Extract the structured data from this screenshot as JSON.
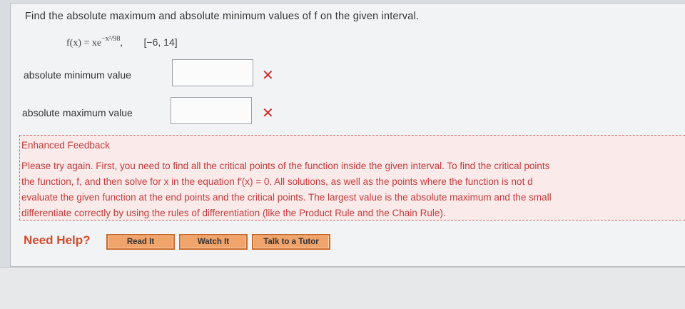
{
  "question": {
    "prompt": "Find the absolute maximum and absolute minimum values of f on the given interval.",
    "function_lhs": "f(x) = xe",
    "function_exponent": "−x²/98",
    "function_comma": ",",
    "interval": "[−6, 14]"
  },
  "answers": [
    {
      "label": "absolute minimum value",
      "value": "",
      "status": "incorrect"
    },
    {
      "label": "absolute maximum value",
      "value": "",
      "status": "incorrect"
    }
  ],
  "feedback": {
    "title": "Enhanced Feedback",
    "lines": [
      "Please try again. First, you need to find all the critical points of the function inside the given interval. To find the critical points",
      "the function,  f,  and then solve for x in the equation  f′(x)  =  0.  All solutions, as well as the points where the function is not d",
      "evaluate the given function at the end points and the critical points. The largest value is the absolute maximum and the small",
      "differentiate correctly by using the rules of differentiation (like the Product Rule and the Chain Rule)."
    ]
  },
  "help": {
    "label": "Need Help?",
    "buttons": [
      "Read It",
      "Watch It",
      "Talk to a Tutor"
    ]
  },
  "icons": {
    "incorrect": "close-icon"
  },
  "colors": {
    "error_red": "#d42a2a",
    "feedback_bg": "#fbeaea",
    "help_orange": "#f0a36a"
  }
}
